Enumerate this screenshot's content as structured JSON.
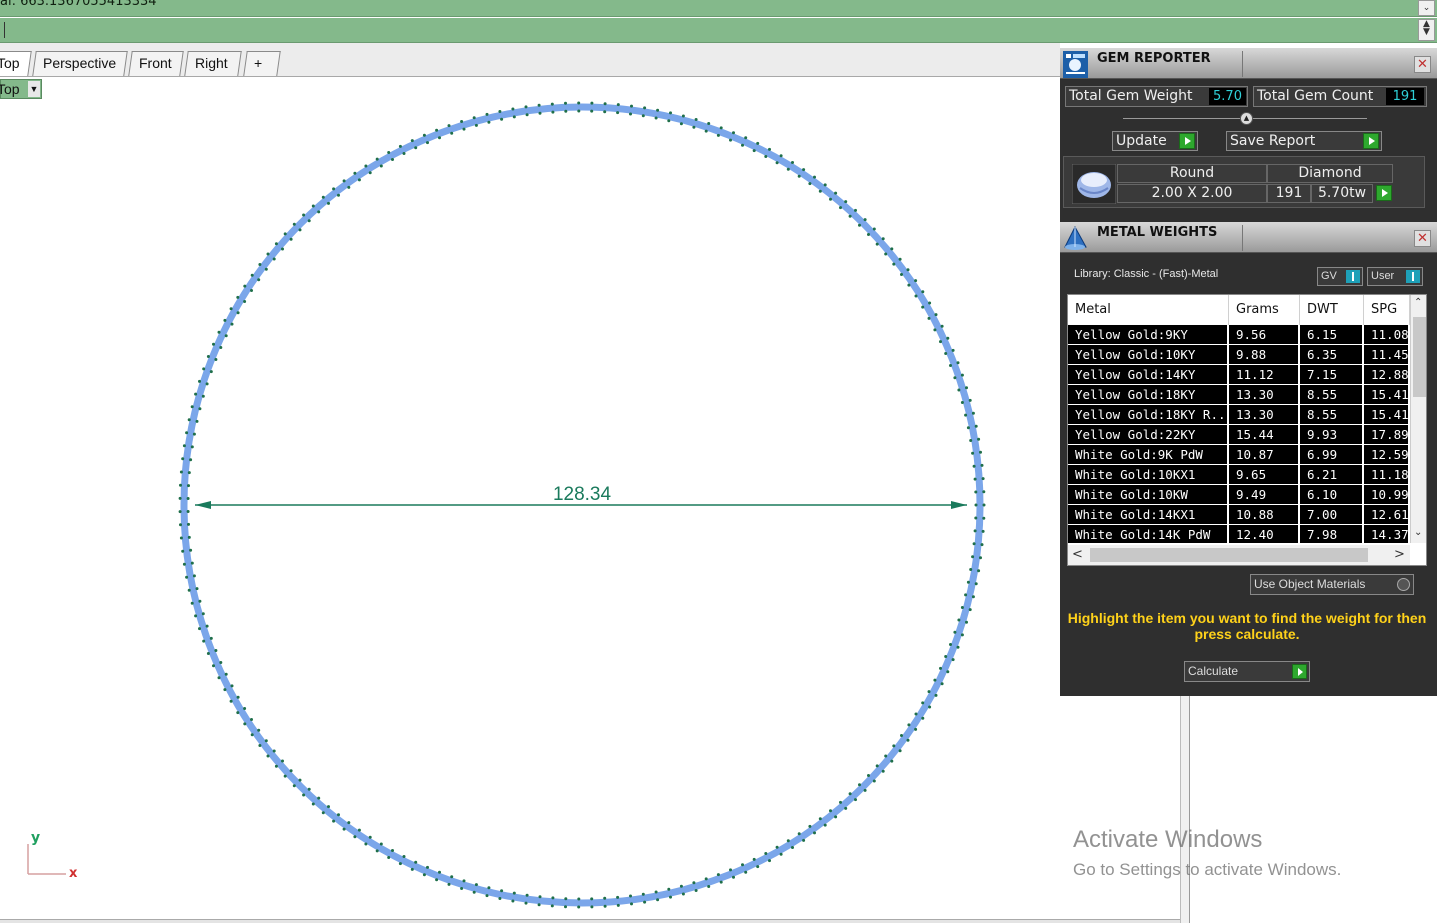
{
  "command": {
    "history_text": "al: 663.1367055413334"
  },
  "tabs": [
    {
      "label": "Top"
    },
    {
      "label": "Perspective"
    },
    {
      "label": "Front"
    },
    {
      "label": "Right"
    },
    {
      "label": "+"
    }
  ],
  "viewport": {
    "label": "Top",
    "dimension": "128.34",
    "axis_y": "y",
    "axis_x": "x",
    "colors": {
      "ring": "#7ba6ea",
      "dimension": "#1a7a5c",
      "gems": "#1f6f4a",
      "axis_x": "#d03030",
      "axis_y": "#20a060"
    }
  },
  "gem_reporter": {
    "title": "GEM REPORTER",
    "total_weight_label": "Total Gem Weight",
    "total_weight": "5.70",
    "total_count_label": "Total Gem Count",
    "total_count": "191",
    "update_label": "Update",
    "save_label": "Save Report",
    "gem": {
      "shape": "Round",
      "type": "Diamond",
      "size": "2.00 X 2.00",
      "count": "191",
      "weight": "5.70tw"
    }
  },
  "metal_weights": {
    "title": "METAL WEIGHTS",
    "library": "Library: Classic - (Fast)-Metal",
    "toggle_gv": "GV",
    "toggle_user": "User",
    "columns": [
      "Metal",
      "Grams",
      "DWT",
      "SPG"
    ],
    "rows": [
      {
        "metal": "Yellow Gold:9KY",
        "grams": "9.56",
        "dwt": "6.15",
        "spg": "11.08"
      },
      {
        "metal": "Yellow Gold:10KY",
        "grams": "9.88",
        "dwt": "6.35",
        "spg": "11.45"
      },
      {
        "metal": "Yellow Gold:14KY",
        "grams": "11.12",
        "dwt": "7.15",
        "spg": "12.88"
      },
      {
        "metal": "Yellow Gold:18KY",
        "grams": "13.30",
        "dwt": "8.55",
        "spg": "15.41"
      },
      {
        "metal": "Yellow Gold:18KY R...",
        "grams": "13.30",
        "dwt": "8.55",
        "spg": "15.41"
      },
      {
        "metal": "Yellow Gold:22KY",
        "grams": "15.44",
        "dwt": "9.93",
        "spg": "17.89"
      },
      {
        "metal": "White Gold:9K PdW",
        "grams": "10.87",
        "dwt": "6.99",
        "spg": "12.59"
      },
      {
        "metal": "White Gold:10KX1",
        "grams": "9.65",
        "dwt": "6.21",
        "spg": "11.18"
      },
      {
        "metal": "White Gold:10KW",
        "grams": "9.49",
        "dwt": "6.10",
        "spg": "10.99"
      },
      {
        "metal": "White Gold:14KX1",
        "grams": "10.88",
        "dwt": "7.00",
        "spg": "12.61"
      },
      {
        "metal": "White Gold:14K PdW",
        "grams": "12.40",
        "dwt": "7.98",
        "spg": "14.37"
      }
    ],
    "use_object_materials": "Use Object Materials",
    "hint": "Highlight the item you want to find the weight for then press calculate.",
    "calculate": "Calculate"
  },
  "watermark": {
    "title": "Activate Windows",
    "subtitle": "Go to Settings to activate Windows."
  }
}
